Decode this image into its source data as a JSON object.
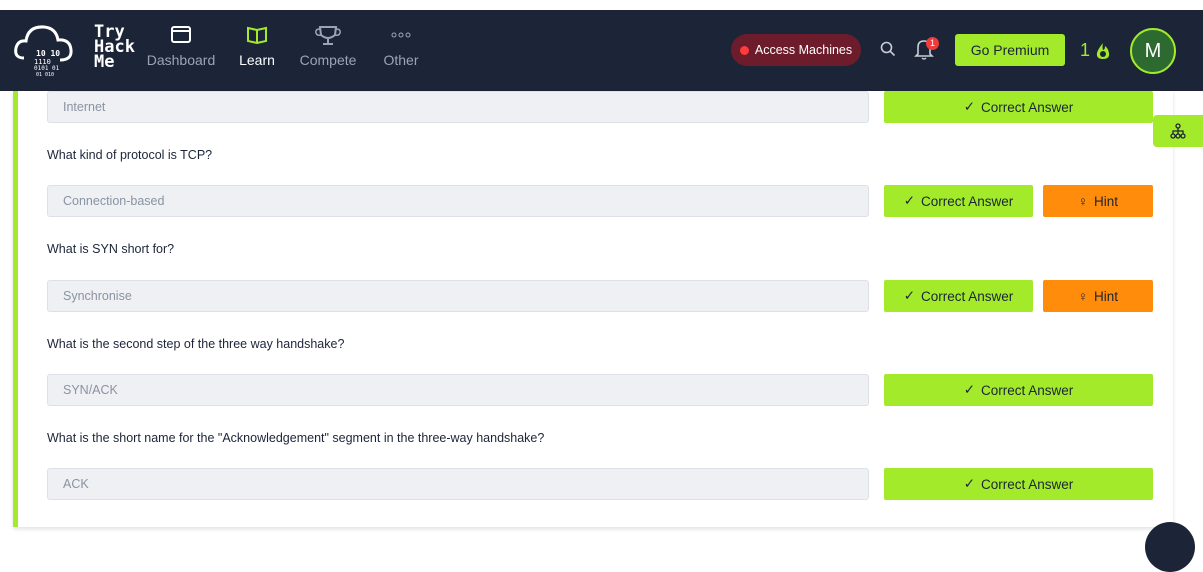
{
  "brand": {
    "line1": "Try",
    "line2": "Hack",
    "line3": "Me"
  },
  "nav": [
    {
      "label": "Dashboard",
      "icon": "dashboard-icon"
    },
    {
      "label": "Learn",
      "icon": "book-icon"
    },
    {
      "label": "Compete",
      "icon": "trophy-icon"
    },
    {
      "label": "Other",
      "icon": "dots-icon"
    }
  ],
  "header": {
    "access_machines": "Access Machines",
    "notification_count": "1",
    "go_premium": "Go Premium",
    "streak": "1",
    "avatar_initial": "M"
  },
  "questions": [
    {
      "question": "",
      "answer": "Internet",
      "has_hint": false
    },
    {
      "question": "What kind of protocol is TCP?",
      "answer": "Connection-based",
      "has_hint": true
    },
    {
      "question": "What is SYN short for?",
      "answer": "Synchronise",
      "has_hint": true
    },
    {
      "question": "What is the second step of the three way handshake?",
      "answer": "SYN/ACK",
      "has_hint": false
    },
    {
      "question": "What is the short name for the \"Acknowledgement\" segment in the three-way handshake?",
      "answer": "ACK",
      "has_hint": false
    }
  ],
  "labels": {
    "correct_answer": "Correct Answer",
    "hint": "Hint"
  },
  "colors": {
    "navbar": "#1c2538",
    "accent": "#a3ea2a",
    "hint": "#ff8c0a",
    "access": "#6c1c2a"
  }
}
